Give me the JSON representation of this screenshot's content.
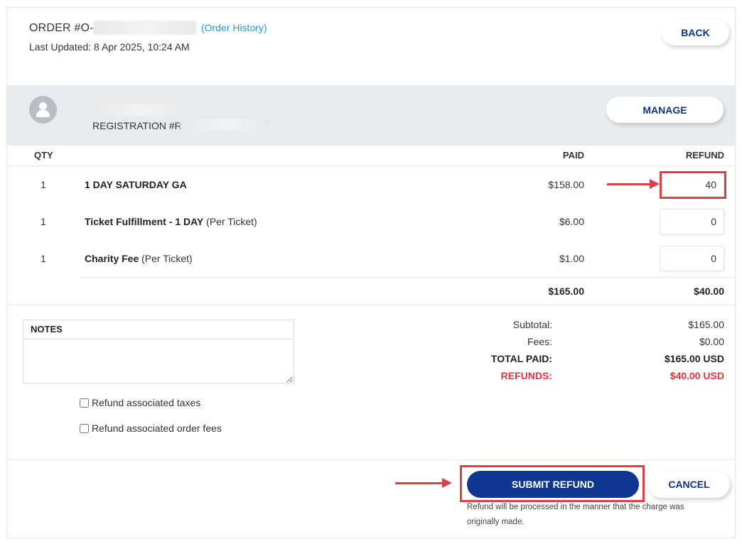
{
  "header": {
    "order_prefix": "ORDER #O-",
    "order_history_link": "(Order History)",
    "last_updated": "Last Updated: 8 Apr 2025, 10:24 AM",
    "back_label": "BACK"
  },
  "registration": {
    "reg_prefix": "REGISTRATION #R-",
    "manage_label": "MANAGE"
  },
  "table": {
    "headers": {
      "qty": "QTY",
      "paid": "PAID",
      "refund": "REFUND"
    },
    "rows": [
      {
        "qty": "1",
        "name": "1 DAY SATURDAY GA",
        "suffix": "",
        "paid": "$158.00",
        "refund": "40"
      },
      {
        "qty": "1",
        "name": "Ticket Fulfillment - 1 DAY",
        "suffix": " (Per Ticket)",
        "paid": "$6.00",
        "refund": "0"
      },
      {
        "qty": "1",
        "name": "Charity Fee",
        "suffix": " (Per Ticket)",
        "paid": "$1.00",
        "refund": "0"
      }
    ],
    "total_paid": "$165.00",
    "total_refund": "$40.00"
  },
  "notes": {
    "label": "NOTES"
  },
  "options": {
    "refund_taxes": "Refund associated taxes",
    "refund_fees": "Refund associated order fees"
  },
  "summary": {
    "subtotal_label": "Subtotal:",
    "subtotal_value": "$165.00",
    "fees_label": "Fees:",
    "fees_value": "$0.00",
    "total_paid_label": "TOTAL PAID:",
    "total_paid_value": "$165.00 USD",
    "refunds_label": "REFUNDS:",
    "refunds_value": "$40.00 USD"
  },
  "footer": {
    "submit_label": "SUBMIT REFUND",
    "cancel_label": "CANCEL",
    "refund_note": "Refund will be processed in the manner that the charge was originally made."
  },
  "colors": {
    "primary": "#0f3690",
    "link": "#1aa1c9",
    "refund_red": "#e2323f",
    "annotation_red": "#d9414a",
    "band_gray": "#e8ecef"
  },
  "icons": [
    "user-avatar-icon",
    "annotation-arrow-icon"
  ]
}
